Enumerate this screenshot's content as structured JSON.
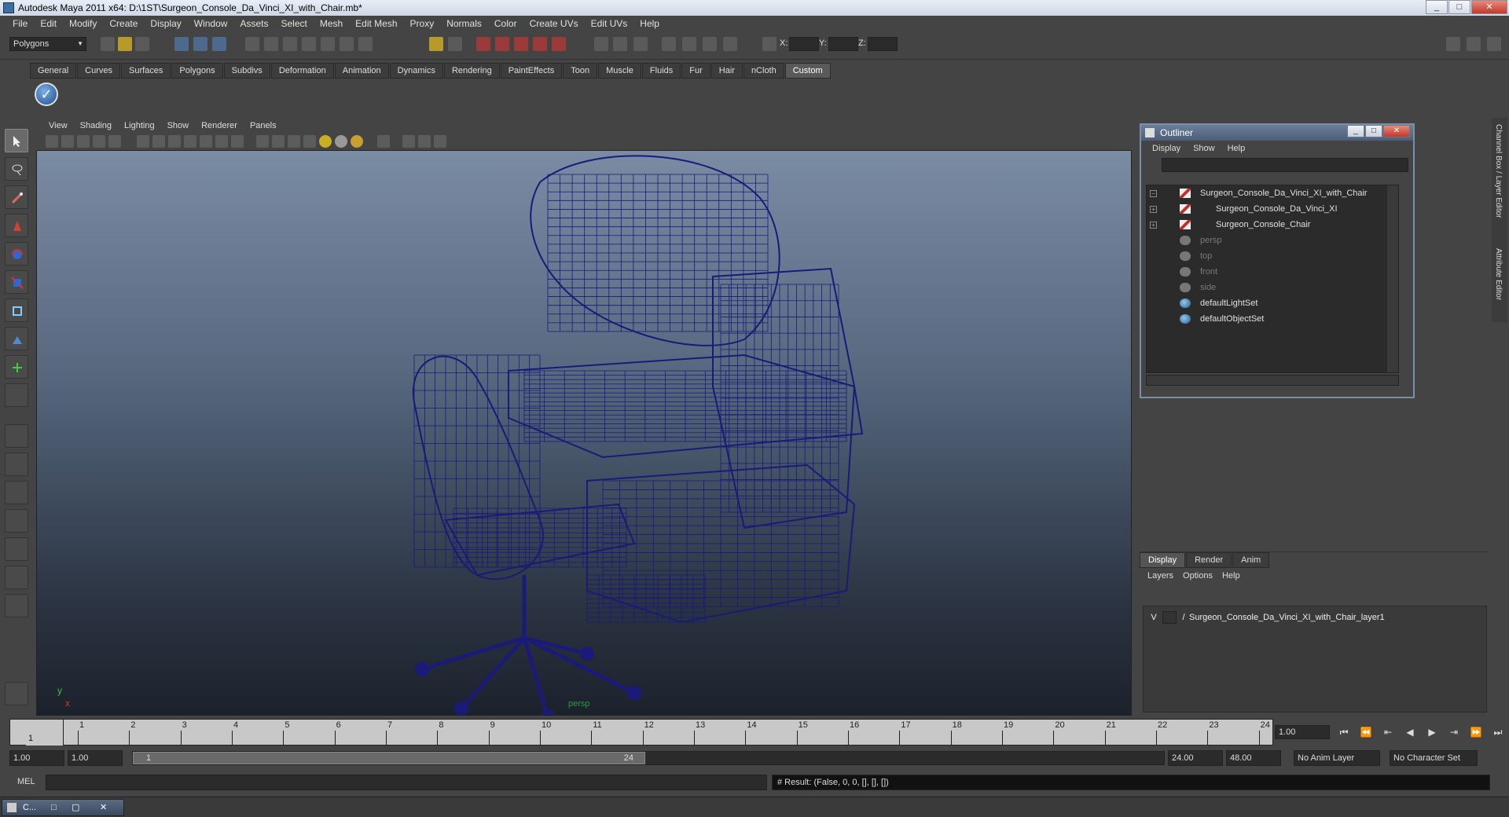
{
  "window": {
    "title": "Autodesk Maya 2011 x64: D:\\1ST\\Surgeon_Console_Da_Vinci_XI_with_Chair.mb*"
  },
  "menubar": [
    "File",
    "Edit",
    "Modify",
    "Create",
    "Display",
    "Window",
    "Assets",
    "Select",
    "Mesh",
    "Edit Mesh",
    "Proxy",
    "Normals",
    "Color",
    "Create UVs",
    "Edit UVs",
    "Help"
  ],
  "statusline": {
    "mode": "Polygons",
    "x_label": "X:",
    "y_label": "Y:",
    "z_label": "Z:"
  },
  "shelf": {
    "tabs": [
      "General",
      "Curves",
      "Surfaces",
      "Polygons",
      "Subdivs",
      "Deformation",
      "Animation",
      "Dynamics",
      "Rendering",
      "PaintEffects",
      "Toon",
      "Muscle",
      "Fluids",
      "Fur",
      "Hair",
      "nCloth",
      "Custom"
    ],
    "active": "Custom"
  },
  "viewport": {
    "menu": [
      "View",
      "Shading",
      "Lighting",
      "Show",
      "Renderer",
      "Panels"
    ],
    "camera": "persp",
    "axis_y": "y",
    "axis_x": "x",
    "wire_color": "#1a1a78"
  },
  "outliner": {
    "title": "Outliner",
    "menu": [
      "Display",
      "Show",
      "Help"
    ],
    "items": [
      {
        "label": "Surgeon_Console_Da_Vinci_XI_with_Chair",
        "expander": "−",
        "type": "mesh",
        "dim": false,
        "indent": 0
      },
      {
        "label": "Surgeon_Console_Da_Vinci_XI",
        "expander": "+",
        "type": "mesh",
        "dim": false,
        "indent": 1
      },
      {
        "label": "Surgeon_Console_Chair",
        "expander": "+",
        "type": "mesh",
        "dim": false,
        "indent": 1
      },
      {
        "label": "persp",
        "expander": "",
        "type": "cam",
        "dim": true,
        "indent": 0
      },
      {
        "label": "top",
        "expander": "",
        "type": "cam",
        "dim": true,
        "indent": 0
      },
      {
        "label": "front",
        "expander": "",
        "type": "cam",
        "dim": true,
        "indent": 0
      },
      {
        "label": "side",
        "expander": "",
        "type": "cam",
        "dim": true,
        "indent": 0
      },
      {
        "label": "defaultLightSet",
        "expander": "",
        "type": "set",
        "dim": false,
        "indent": 0
      },
      {
        "label": "defaultObjectSet",
        "expander": "",
        "type": "set",
        "dim": false,
        "indent": 0
      }
    ]
  },
  "sidebar": {
    "tab1": "Channel Box / Layer Editor",
    "tab2": "Attribute Editor"
  },
  "layer_editor": {
    "tabs": [
      "Display",
      "Render",
      "Anim"
    ],
    "active": "Display",
    "menu": [
      "Layers",
      "Options",
      "Help"
    ],
    "layers": [
      {
        "visible": "V",
        "name": "Surgeon_Console_Da_Vinci_XI_with_Chair_layer1"
      }
    ]
  },
  "timeline": {
    "ticks": [
      "1",
      "2",
      "3",
      "4",
      "5",
      "6",
      "7",
      "8",
      "9",
      "10",
      "11",
      "12",
      "13",
      "14",
      "15",
      "16",
      "17",
      "18",
      "19",
      "20",
      "21",
      "22",
      "23",
      "24"
    ],
    "current_label": "1",
    "current_frame": "1.00"
  },
  "range": {
    "start": "1.00",
    "anim_start": "1.00",
    "handle_start": "1",
    "handle_end": "24",
    "end": "24.00",
    "anim_end": "48.00",
    "anim_layer": "No Anim Layer",
    "character_set": "No Character Set"
  },
  "command": {
    "lang": "MEL",
    "result": "# Result: (False, 0, 0, [], [], [])"
  },
  "taskbar": {
    "item": "C..."
  }
}
